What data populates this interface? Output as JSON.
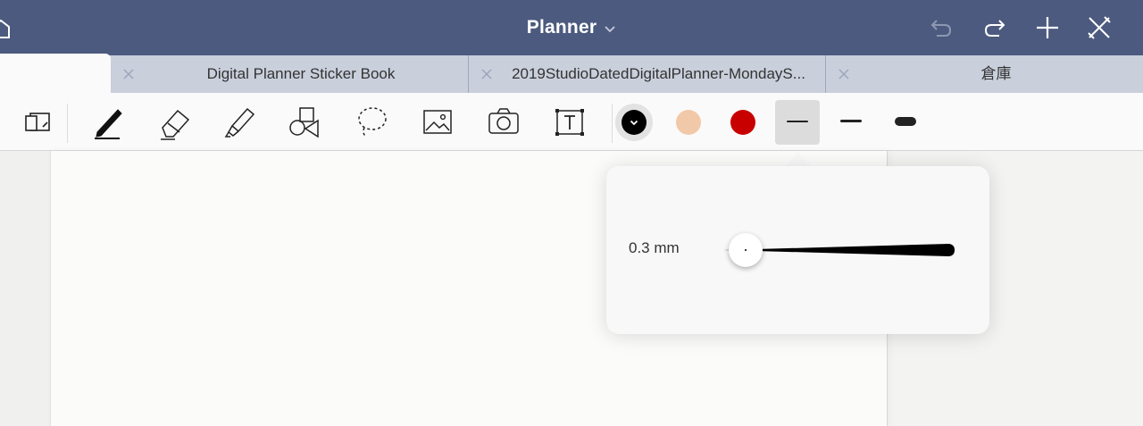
{
  "app": {
    "title": "Planner"
  },
  "tabs": [
    {
      "label": ""
    },
    {
      "label": "Digital Planner Sticker Book"
    },
    {
      "label": "2019StudioDatedDigitalPlanner-MondayS..."
    },
    {
      "label": "倉庫"
    }
  ],
  "toolbar": {
    "tools": [
      "page-view-icon",
      "pen-icon",
      "eraser-icon",
      "highlighter-icon",
      "shapes-icon",
      "lasso-icon",
      "image-icon",
      "camera-icon",
      "text-box-icon"
    ],
    "colors": [
      "#000000",
      "#f2c9a8",
      "#c80000"
    ],
    "selected_color": "#000000",
    "stroke_widths": [
      "thin",
      "medium",
      "thick"
    ],
    "selected_stroke": "thin"
  },
  "pen_size_popover": {
    "size_label": "0.3 mm",
    "slider_value_fraction": 0.0
  },
  "colors": {
    "titlebar": "#4c5a7f",
    "tabbar": "#c9cfdb"
  }
}
